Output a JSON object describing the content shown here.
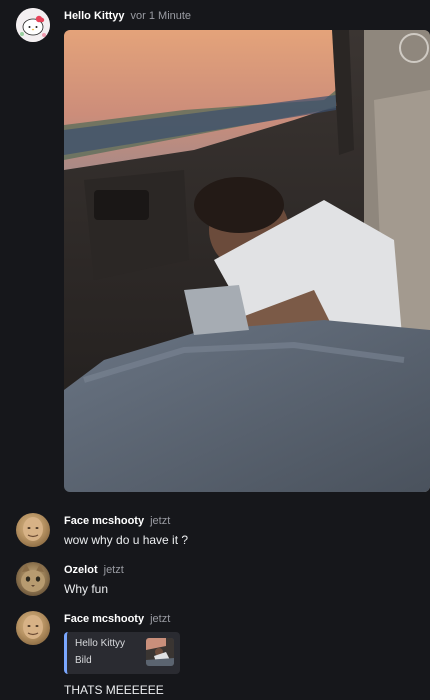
{
  "messages": [
    {
      "author": "Hello Kittyy",
      "time": "vor 1 Minute",
      "avatar_icon": "hello-kitty-avatar",
      "attachment": {
        "type": "image"
      }
    },
    {
      "author": "Face mcshooty",
      "time": "jetzt",
      "avatar_icon": "face-avatar",
      "text": "wow why do u have it ?"
    },
    {
      "author": "Ozelot",
      "time": "jetzt",
      "avatar_icon": "cat-avatar",
      "text": "Why fun"
    },
    {
      "author": "Face mcshooty",
      "time": "jetzt",
      "avatar_icon": "face-avatar",
      "reply": {
        "author": "Hello Kittyy",
        "type": "Bild"
      },
      "text": "THATS MEEEEEE"
    }
  ],
  "colors": {
    "background": "#16171b",
    "reply_accent": "#7aa7ff"
  }
}
